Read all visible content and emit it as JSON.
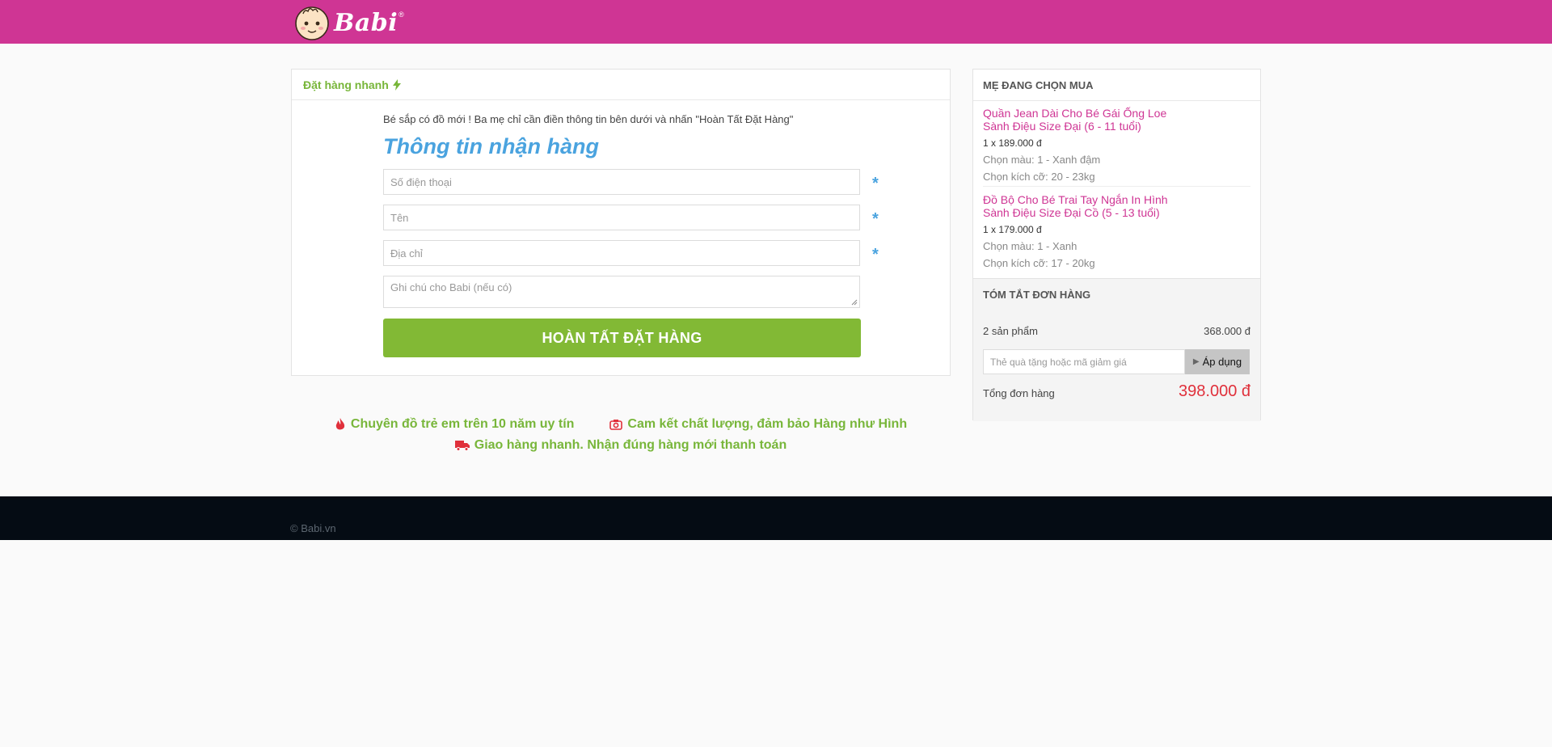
{
  "header": {
    "logo_text": "Babi",
    "logo_reg": "®"
  },
  "quick_order": {
    "title": "Đặt hàng nhanh",
    "intro": "Bé sắp có đồ mới ! Ba mẹ chỉ cần điền thông tin bên dưới và nhấn \"Hoàn Tất Đặt Hàng\"",
    "form_title": "Thông tin nhận hàng",
    "fields": [
      {
        "placeholder": "Số điện thoại",
        "required": true
      },
      {
        "placeholder": "Tên",
        "required": true
      },
      {
        "placeholder": "Địa chỉ",
        "required": true
      },
      {
        "placeholder": "Ghi chú cho Babi (nếu có)",
        "required": false
      }
    ],
    "required_mark": "*",
    "submit_label": "HOÀN TẤT ĐẶT HÀNG"
  },
  "perks": [
    {
      "icon": "fire-icon",
      "text": "Chuyên đồ trẻ em trên 10 năm uy tín"
    },
    {
      "icon": "camera-icon",
      "text": "Cam kết chất lượng, đảm bảo Hàng như Hình"
    },
    {
      "icon": "truck-icon",
      "text": "Giao hàng nhanh. Nhận đúng hàng mới thanh toán"
    }
  ],
  "cart": {
    "title": "MẸ ĐANG CHỌN MUA",
    "items": [
      {
        "name_line1": "Quần Jean Dài Cho Bé Gái Ống Loe",
        "name_line2": "Sành Điệu Size Đại (6 - 11 tuổi)",
        "qty_price": "1 x 189.000 đ",
        "color": "Chọn màu: 1 - Xanh đậm",
        "size": "Chọn kích cỡ: 20 - 23kg"
      },
      {
        "name_line1": "Đồ Bộ Cho Bé Trai Tay Ngắn In Hình",
        "name_line2": "Sành Điệu Size Đại Cồ (5 - 13 tuổi)",
        "qty_price": "1 x 179.000 đ",
        "color": "Chọn màu: 1 - Xanh",
        "size": "Chọn kích cỡ: 17 - 20kg"
      }
    ]
  },
  "summary": {
    "title": "TÓM TẮT ĐƠN HÀNG",
    "count": "2 sản phẩm",
    "subtotal": "368.000 đ",
    "coupon_placeholder": "Thẻ quà tặng hoặc mã giảm giá",
    "apply_label": "Áp dụng",
    "total_label": "Tổng đơn hàng",
    "total_value": "398.000 đ"
  },
  "footer": {
    "copyright": "© Babi.vn"
  },
  "colors": {
    "brand": "#cf3594",
    "accent_green": "#82b935",
    "accent_blue": "#4aa3df",
    "price_red": "#e0303b",
    "footer_bg": "#050c14"
  }
}
